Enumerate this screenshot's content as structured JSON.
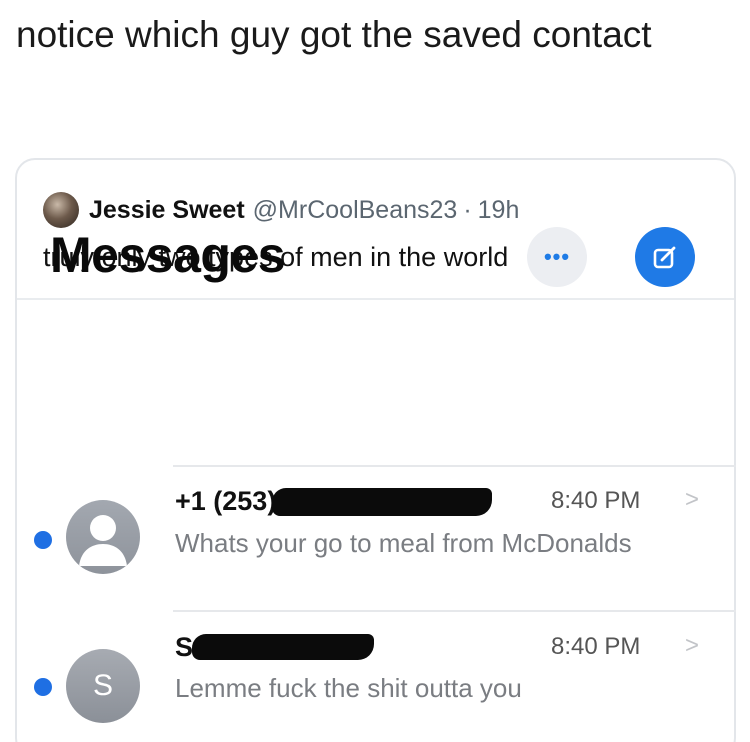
{
  "caption": "notice which guy got the saved contact",
  "tweet": {
    "name": "Jessie Sweet",
    "handle": "@MrCoolBeans23",
    "separator": "·",
    "time": "19h",
    "text": "truly only two types of men in the world"
  },
  "messages": {
    "title": "Messages",
    "more_label": "•••",
    "conversations": [
      {
        "sender": "+1 (253)",
        "time": "8:40 PM",
        "chevron": ">",
        "preview": "Whats your go to meal from McDonalds",
        "unread": true
      },
      {
        "sender": "S",
        "avatar_initial": "S",
        "time": "8:40 PM",
        "chevron": ">",
        "preview": "Lemme fuck the shit outta you",
        "unread": true
      }
    ]
  },
  "colors": {
    "accent": "#1f7ae6",
    "unread": "#1f6fe3",
    "redaction": "#0b0b0b"
  }
}
